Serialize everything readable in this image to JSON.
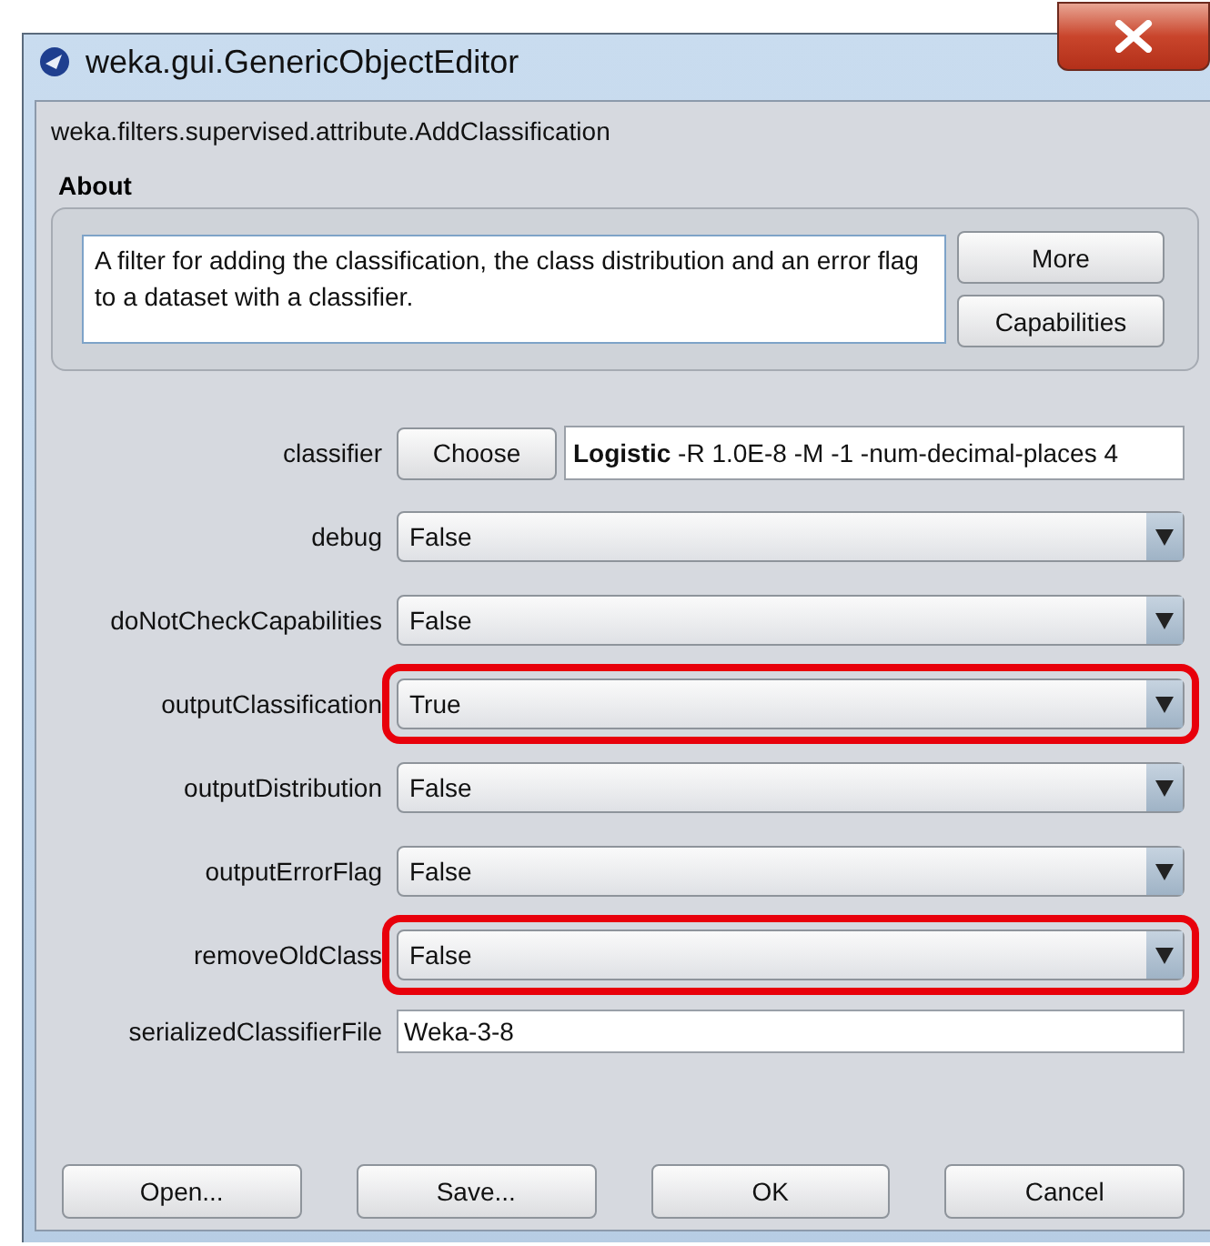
{
  "window": {
    "title": "weka.gui.GenericObjectEditor"
  },
  "class_name": "weka.filters.supervised.attribute.AddClassification",
  "about": {
    "heading": "About",
    "text": "A filter for adding the classification, the class distribution and an error flag to a dataset with a classifier.",
    "buttons": [
      "More",
      "Capabilities"
    ]
  },
  "properties": [
    {
      "kind": "chooser",
      "label": "classifier",
      "button": "Choose",
      "value": "**Logistic** -R 1.0E-8 -M -1 -num-decimal-places 4",
      "highlighted": false
    },
    {
      "kind": "dropdown",
      "label": "debug",
      "value": "False",
      "highlighted": false
    },
    {
      "kind": "dropdown",
      "label": "doNotCheckCapabilities",
      "value": "False",
      "highlighted": false
    },
    {
      "kind": "dropdown",
      "label": "outputClassification",
      "value": "True",
      "highlighted": true
    },
    {
      "kind": "dropdown",
      "label": "outputDistribution",
      "value": "False",
      "highlighted": false
    },
    {
      "kind": "dropdown",
      "label": "outputErrorFlag",
      "value": "False",
      "highlighted": false
    },
    {
      "kind": "dropdown",
      "label": "removeOldClass",
      "value": "False",
      "highlighted": true
    },
    {
      "kind": "text",
      "label": "serializedClassifierFile",
      "value": "Weka-3-8",
      "highlighted": false
    }
  ],
  "buttons": [
    "Open...",
    "Save...",
    "OK",
    "Cancel"
  ]
}
